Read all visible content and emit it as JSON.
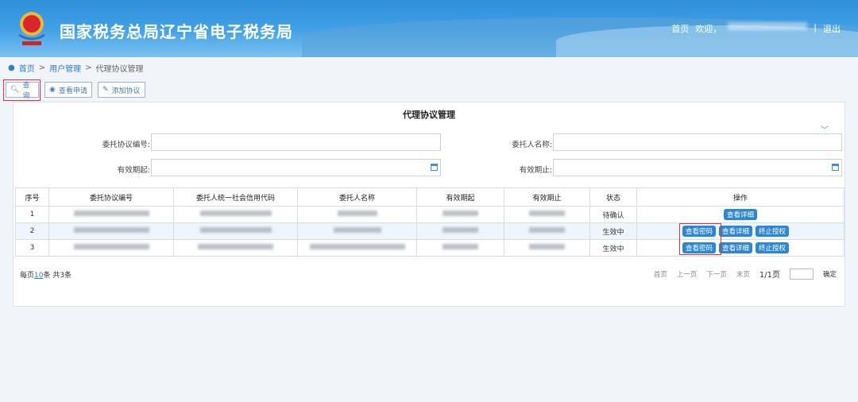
{
  "header": {
    "title": "国家税务总局辽宁省电子税务局",
    "home": "首页",
    "welcome": "欢迎，",
    "separator": "|",
    "logout": "退出"
  },
  "breadcrumb": [
    "首页",
    ">",
    "用户管理",
    ">",
    "代理协议管理"
  ],
  "toolbar": {
    "query": "查询",
    "view_apply": "查看申请",
    "add_agreement": "添加协议"
  },
  "page_title": "代理协议管理",
  "form": {
    "agreement_no": "委托协议编号:",
    "client_name": "委托人名称:",
    "valid_from": "有效期起:",
    "valid_to": "有效期止:"
  },
  "table": {
    "headers": [
      "序号",
      "委托协议编号",
      "委托人统一社会信用代码",
      "委托人名称",
      "有效期起",
      "有效期止",
      "状态",
      "操作"
    ],
    "rows": [
      {
        "no": "1",
        "status": "待确认",
        "actions": [
          "查看详细"
        ]
      },
      {
        "no": "2",
        "status": "生效中",
        "actions": [
          "查看密码",
          "查看详细",
          "终止授权"
        ]
      },
      {
        "no": "3",
        "status": "生效中",
        "actions": [
          "查看密码",
          "查看详细",
          "终止授权"
        ]
      }
    ]
  },
  "pagination": {
    "per_page_prefix": "每页",
    "per_page": "10",
    "per_page_suffix": "条 共3条",
    "first": "首页",
    "prev": "上一页",
    "next": "下一页",
    "last": "末页",
    "current": "1/1页",
    "confirm": "确定"
  },
  "colors": {
    "accent": "#2c86d4",
    "highlight": "#d9343a"
  }
}
